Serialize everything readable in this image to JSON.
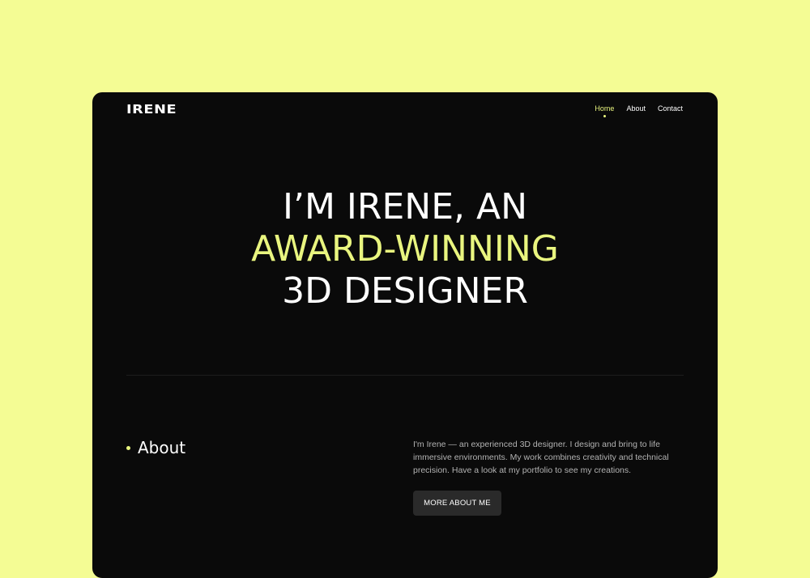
{
  "colors": {
    "page_background": "#f4fc94",
    "window_background": "#0a0a0a",
    "accent": "#e9f57f",
    "text": "#ffffff",
    "muted_text": "#b3b3b3",
    "button_background": "#2a2a2a"
  },
  "header": {
    "logo": "IRENE",
    "nav": [
      {
        "label": "Home",
        "active": true
      },
      {
        "label": "About",
        "active": false
      },
      {
        "label": "Contact",
        "active": false
      }
    ]
  },
  "hero": {
    "line1": "I’M IRENE, AN",
    "line2": "AWARD-WINNING",
    "line3": "3D DESIGNER"
  },
  "about": {
    "title": "About",
    "text": "I'm Irene — an experienced 3D designer. I design and bring to life immersive environments. My work combines creativity and technical precision. Have a look at my portfolio to see my creations.",
    "button_label": "MORE ABOUT ME"
  }
}
